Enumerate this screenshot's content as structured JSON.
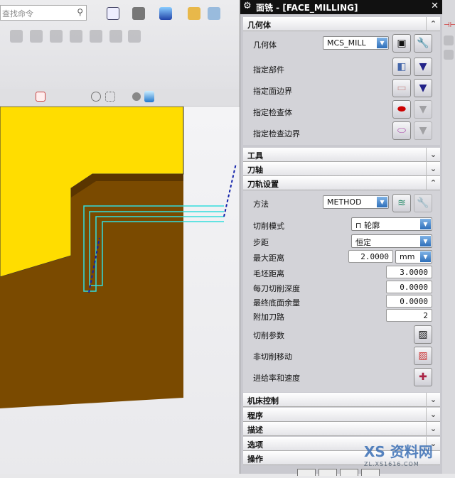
{
  "toolbar": {
    "search_placeholder": "查找命令"
  },
  "panel": {
    "title": "面铣 - [FACE_MILLING]",
    "sections": {
      "geometry": "几何体",
      "tool": "工具",
      "axis": "刀轴",
      "path": "刀轨设置",
      "machine": "机床控制",
      "program": "程序",
      "desc": "描述",
      "options": "选项",
      "actions": "操作"
    },
    "geometry": {
      "geometry_label": "几何体",
      "geometry_value": "MCS_MILL",
      "part": "指定部件",
      "face_boundary": "指定面边界",
      "check_body": "指定检查体",
      "check_boundary": "指定检查边界"
    },
    "path": {
      "method_label": "方法",
      "method_value": "METHOD",
      "cut_pattern_label": "切削模式",
      "cut_pattern_value": "轮廓",
      "stepover_label": "步距",
      "stepover_value": "恒定",
      "max_dist_label": "最大距离",
      "max_dist_value": "2.0000",
      "max_dist_unit": "mm",
      "blank_dist_label": "毛坯距离",
      "blank_dist_value": "3.0000",
      "depth_label": "每刀切削深度",
      "depth_value": "0.0000",
      "floor_stock_label": "最终底面余量",
      "floor_stock_value": "0.0000",
      "extra_passes_label": "附加刀路",
      "extra_passes_value": "2",
      "cut_params": "切削参数",
      "non_cut": "非切削移动",
      "feeds": "进给率和速度"
    }
  },
  "watermark": {
    "text": "资料网",
    "url": "ZL.XS1616.COM"
  }
}
